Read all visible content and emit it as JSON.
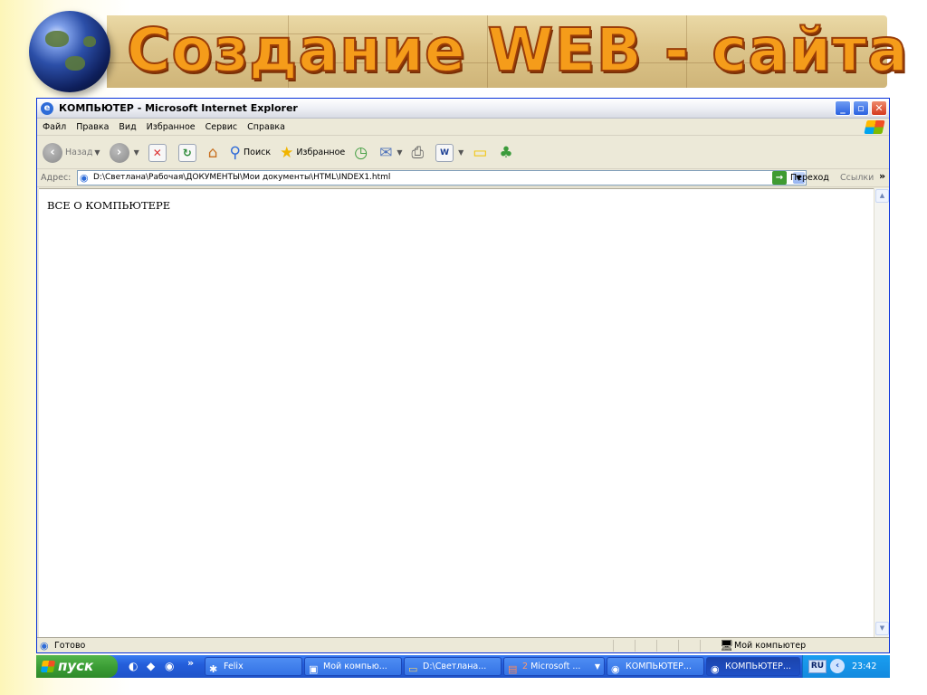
{
  "slide": {
    "title": "Создание WEB - сайта"
  },
  "window": {
    "title": "КОМПЬЮТЕР - Microsoft Internet Explorer",
    "menu": [
      "Файл",
      "Правка",
      "Вид",
      "Избранное",
      "Сервис",
      "Справка"
    ],
    "toolbar": {
      "back_label": "Назад",
      "search_label": "Поиск",
      "favorites_label": "Избранное"
    },
    "address": {
      "label": "Адрес:",
      "value": "D:\\Светлана\\Рабочая\\ДОКУМЕНТЫ\\Мои документы\\HTML\\INDEX1.html",
      "go_label": "Переход",
      "links_label": "Ссылки"
    },
    "content": {
      "text": "ВСЕ О КОМПЬЮТЕРЕ"
    },
    "status": {
      "text": "Готово",
      "zone": "Мой компьютер"
    }
  },
  "taskbar": {
    "start_label": "пуск",
    "buttons": [
      {
        "label": "Felix",
        "icon": "felix-icon"
      },
      {
        "label": "Мой компью...",
        "icon": "my-computer-icon"
      },
      {
        "label": "D:\\Светлана...",
        "icon": "folder-icon"
      },
      {
        "count": "2",
        "label": "Microsoft ...",
        "icon": "powerpoint-icon"
      },
      {
        "label": "КОМПЬЮТЕР...",
        "icon": "ie-icon"
      },
      {
        "label": "КОМПЬЮТЕР...",
        "icon": "ie-icon"
      }
    ],
    "tray": {
      "language": "RU",
      "clock": "23:42"
    }
  },
  "colors": {
    "title_fill": "#f59c1a",
    "title_outline": "#9a3d08",
    "xp_blue": "#245edb",
    "start_green": "#3a9c34"
  }
}
